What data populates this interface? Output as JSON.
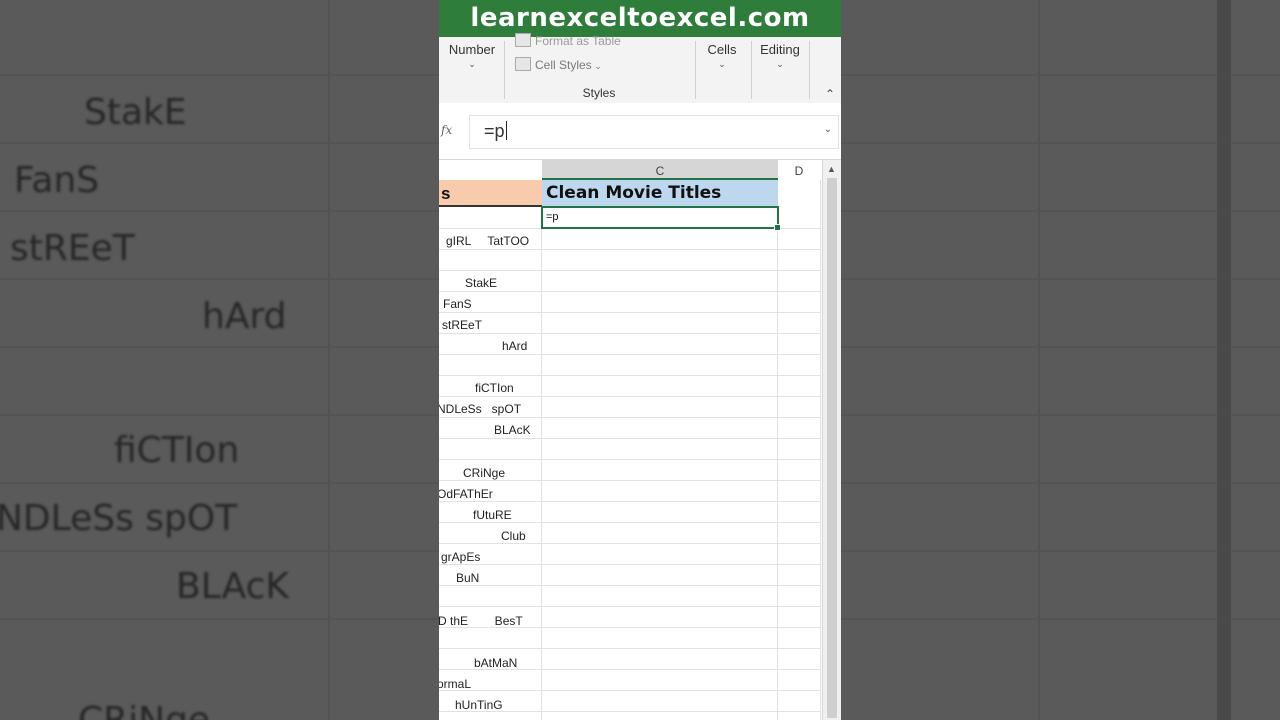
{
  "banner": {
    "site": "learnexceltoexcel.com"
  },
  "ribbon": {
    "number_label": "Number",
    "format_as_table_label": "Format as Table",
    "cell_styles_label": "Cell Styles",
    "styles_group_label": "Styles",
    "cells_label": "Cells",
    "editing_label": "Editing",
    "collapse_icon": "chevron-up-icon"
  },
  "formula_bar": {
    "fx_label": "fx",
    "value": "=p"
  },
  "columns": {
    "c": "C",
    "d": "D"
  },
  "headers": {
    "col_b": "s",
    "col_c": "Clean Movie Titles"
  },
  "active_cell": {
    "value": "=p"
  },
  "movie_rows": [
    "gIRL     TatTOO",
    "StakE",
    "FanS",
    "stREeT",
    "hArd",
    "fiCTIon",
    "NDLeSs   spOT",
    "BLAcK",
    "CRiNge",
    "OdFAThEr",
    "fUtuRE",
    "Club",
    "grApEs",
    "BuN",
    "D thE        BesT",
    "bAtMaN",
    "ormaL",
    "hUnTinG"
  ],
  "background_text": [
    "StakE",
    "FanS",
    "stREeT",
    "hArd",
    "fiCTIon",
    "NDLeSs   spOT",
    "BLAcK",
    "CRiNge"
  ],
  "colors": {
    "banner": "#2e7d3b",
    "header_orange": "#f7cbac",
    "header_blue": "#bdd7ee",
    "selection": "#217346"
  }
}
